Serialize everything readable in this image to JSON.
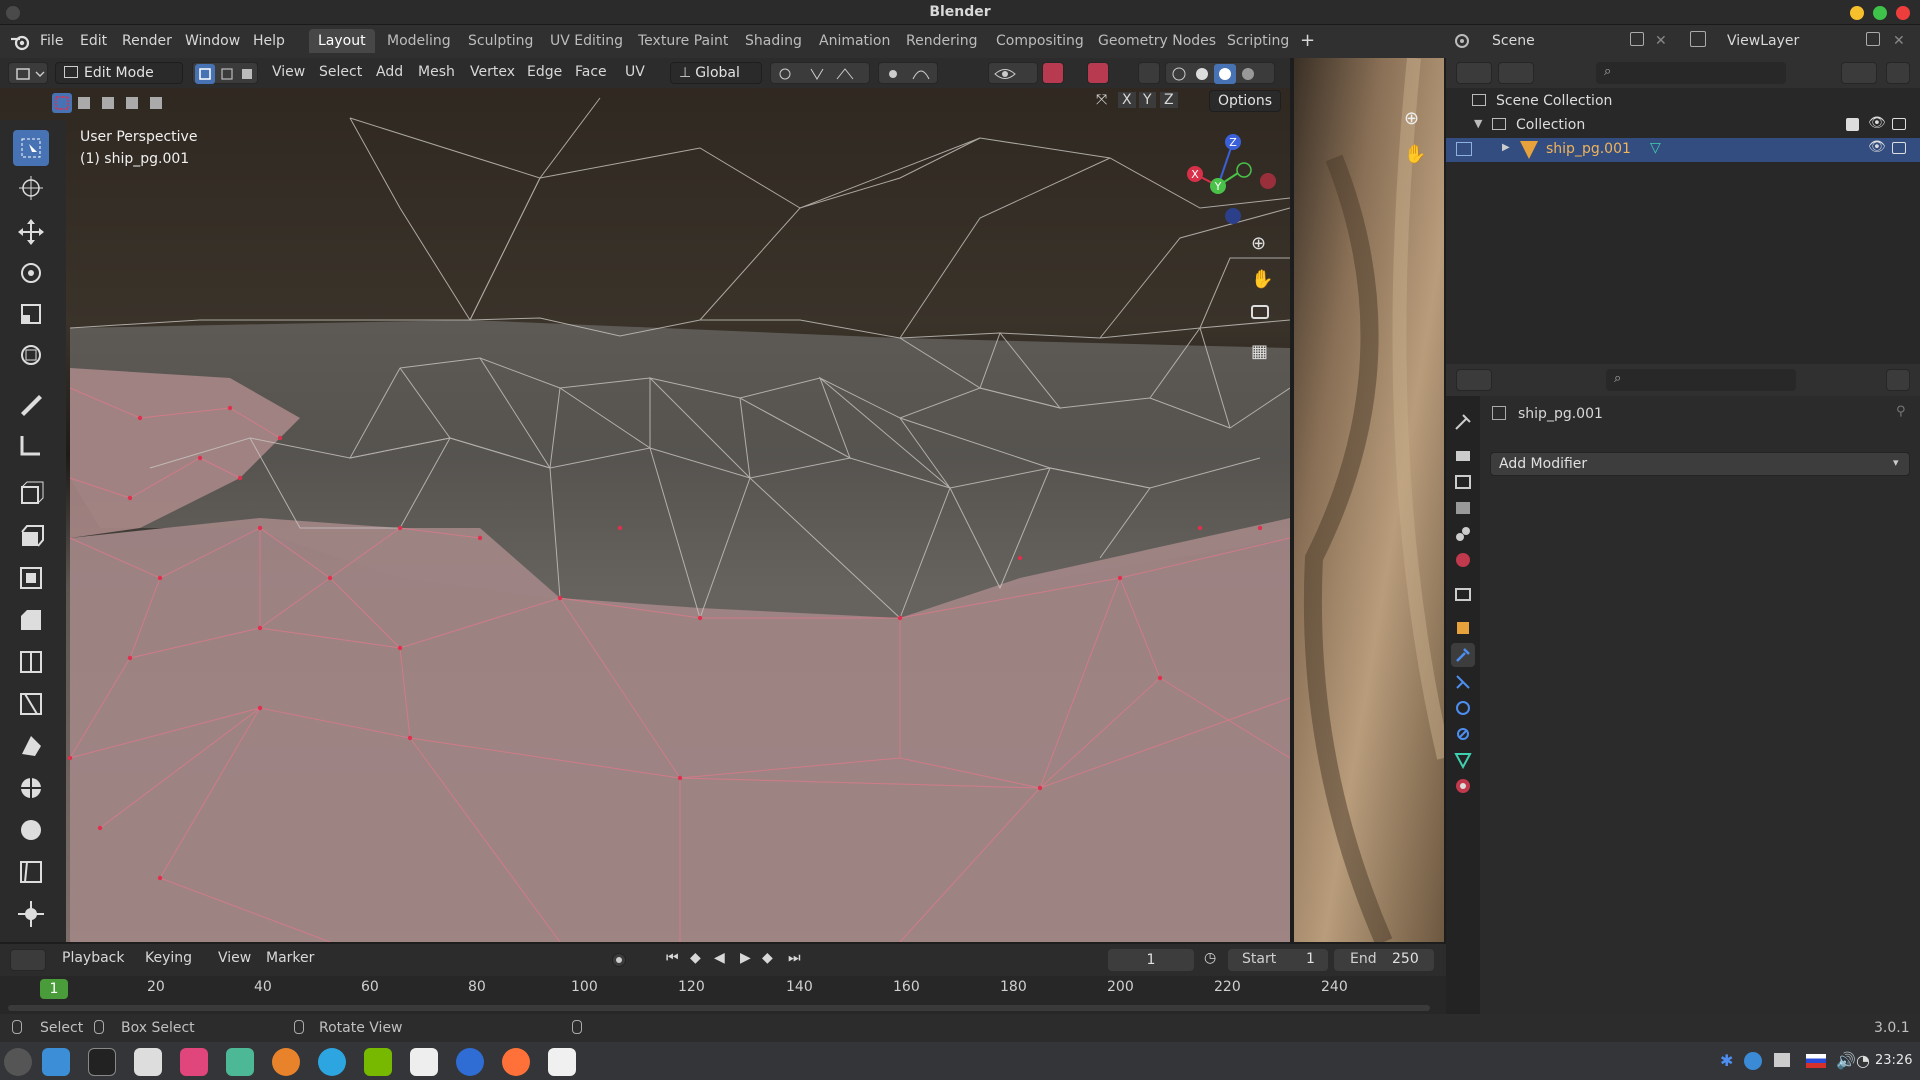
{
  "window": {
    "title": "Blender"
  },
  "menu": {
    "items": [
      "File",
      "Edit",
      "Render",
      "Window",
      "Help"
    ]
  },
  "workspaces": {
    "tabs": [
      "Layout",
      "Modeling",
      "Sculpting",
      "UV Editing",
      "Texture Paint",
      "Shading",
      "Animation",
      "Rendering",
      "Compositing",
      "Geometry Nodes",
      "Scripting"
    ],
    "active": "Layout"
  },
  "scene": {
    "name": "Scene",
    "view_layer": "ViewLayer"
  },
  "viewport": {
    "mode": "Edit Mode",
    "menus": [
      "View",
      "Select",
      "Add",
      "Mesh",
      "Vertex",
      "Edge",
      "Face",
      "UV"
    ],
    "transform_orientation": "Global",
    "overlay_title": "User Perspective",
    "overlay_object": "(1) ship_pg.001",
    "options_label": "Options",
    "axis_labels": [
      "X",
      "Y",
      "Z"
    ]
  },
  "outliner": {
    "scene_collection": "Scene Collection",
    "collection": "Collection",
    "object": "ship_pg.001"
  },
  "properties": {
    "object_name": "ship_pg.001",
    "add_modifier": "Add Modifier"
  },
  "timeline": {
    "menus": [
      "Playback",
      "Keying",
      "View",
      "Marker"
    ],
    "current_frame": "1",
    "start_label": "Start",
    "start": "1",
    "end_label": "End",
    "end": "250",
    "ticks": [
      "1",
      "20",
      "40",
      "60",
      "80",
      "100",
      "120",
      "140",
      "160",
      "180",
      "200",
      "220",
      "240"
    ]
  },
  "statusbar": {
    "select": "Select",
    "box_select": "Box Select",
    "rotate_view": "Rotate View",
    "version": "3.0.1"
  },
  "system": {
    "clock": "23:26"
  },
  "colors": {
    "accent": "#4772b3",
    "selected_row": "#334d80",
    "object_orange": "#e8a23c",
    "mesh_selected": "#d63a55"
  }
}
